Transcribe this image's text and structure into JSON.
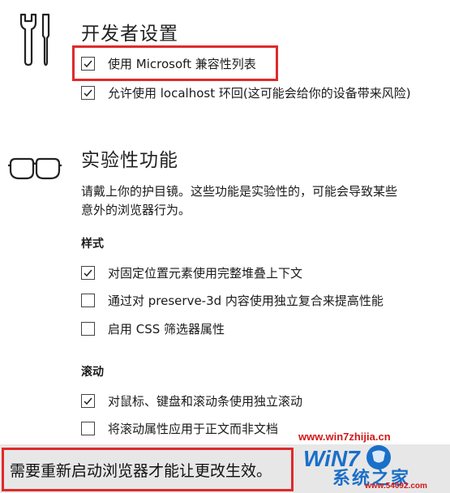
{
  "developer": {
    "title": "开发者设置",
    "items": [
      {
        "label": "使用 Microsoft 兼容性列表",
        "checked": true
      },
      {
        "label": "允许使用 localhost 环回(这可能会给你的设备带来风险)",
        "checked": true
      }
    ]
  },
  "experimental": {
    "title": "实验性功能",
    "description_line1": "请戴上你的护目镜。这些功能是实验性的，可能会导致某些",
    "description_line2": "意外的浏览器行为。"
  },
  "style": {
    "heading": "样式",
    "items": [
      {
        "label": "对固定位置元素使用完整堆叠上下文",
        "checked": true
      },
      {
        "label": "通过对 preserve-3d 内容使用独立复合来提高性能",
        "checked": false
      },
      {
        "label": "启用 CSS 筛选器属性",
        "checked": false
      }
    ]
  },
  "scroll": {
    "heading": "滚动",
    "items": [
      {
        "label": "对鼠标、键盘和滚动条使用独立滚动",
        "checked": true
      },
      {
        "label": "将滚动属性应用于正文而非文档",
        "checked": false
      }
    ]
  },
  "banner": {
    "text": "需要重新启动浏览器才能让更改生效。"
  },
  "watermark": {
    "site": "www.win7zhijia.cn",
    "logo_text": "WiN7",
    "brand": "系统之家",
    "url": "www.54092.com"
  },
  "colors": {
    "highlight_box": "#e02a2a",
    "banner_bg": "#e7e7e7",
    "watermark_red": "#d01818",
    "watermark_blue": "#1a6fc8"
  }
}
